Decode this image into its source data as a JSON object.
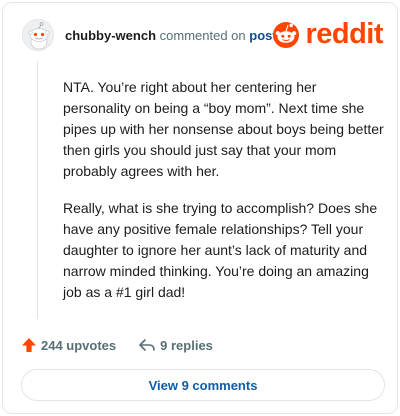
{
  "comment": {
    "author": "chubby-wench",
    "commented_text": "commented on",
    "post_link": "post",
    "avatar_icon": "reddit-snoo-avatar",
    "paragraphs": [
      "NTA. You’re right about her centering her personality on being a “boy mom”. Next time she pipes up with her nonsense about boys being better then girls you should just say that your mom probably agrees with her.",
      "Really, what is she trying to accomplish? Does she have any positive female relationships? Tell your daughter to ignore her aunt’s lack of maturity and narrow minded thinking. You’re doing an amazing job as a #1 girl dad!"
    ]
  },
  "brand": {
    "logo_text": "reddit",
    "logo_icon": "reddit-snoo-icon",
    "color": "#ff4500"
  },
  "actions": {
    "upvotes": "244 upvotes",
    "upvote_icon": "upvote-arrow-icon",
    "replies": "9 replies",
    "reply_icon": "reply-arrow-icon"
  },
  "footer": {
    "view_comments": "View 9 comments"
  }
}
